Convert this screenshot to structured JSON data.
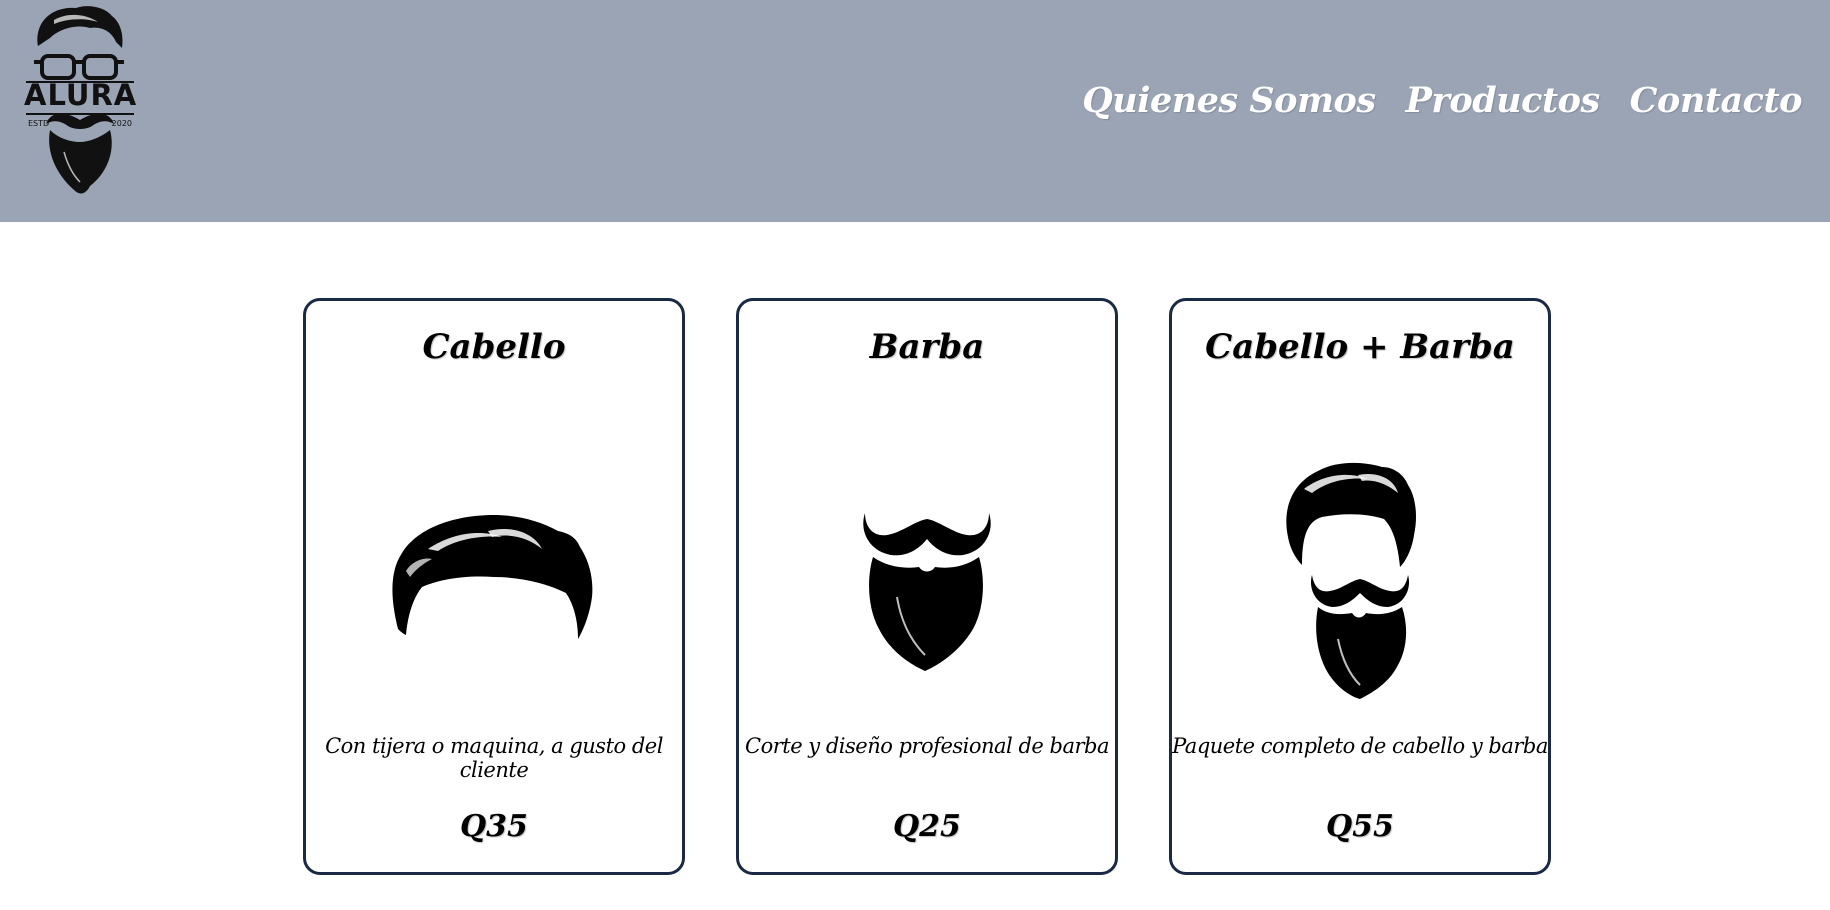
{
  "header": {
    "logo": {
      "name": "ALURA",
      "estd": "ESTD",
      "year": "2020",
      "icon": "bearded-man-glasses-logo"
    },
    "background": "#9aa4b5",
    "nav": [
      {
        "label": "Quienes Somos"
      },
      {
        "label": "Productos"
      },
      {
        "label": "Contacto"
      }
    ]
  },
  "products": [
    {
      "title": "Cabello",
      "icon": "hair-icon",
      "description": "Con tijera o maquina, a gusto del cliente",
      "price": "Q35"
    },
    {
      "title": "Barba",
      "icon": "beard-icon",
      "description": "Corte y diseño profesional de barba",
      "price": "Q25"
    },
    {
      "title": "Cabello + Barba",
      "icon": "hair-and-beard-icon",
      "description": "Paquete completo de cabello y barba",
      "price": "Q55"
    }
  ],
  "colors": {
    "card_border": "#1a2a44",
    "nav_text": "#ffffff"
  }
}
